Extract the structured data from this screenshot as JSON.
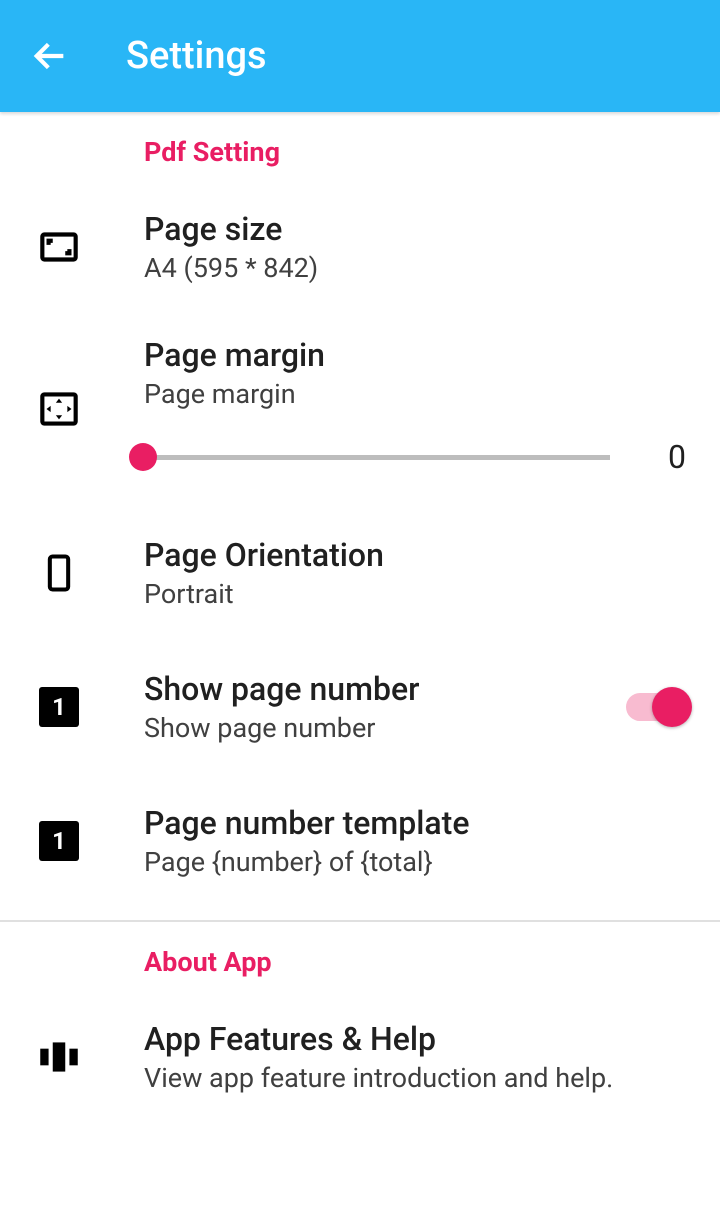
{
  "header": {
    "title": "Settings"
  },
  "sections": {
    "pdf": {
      "header": "Pdf Setting",
      "page_size": {
        "title": "Page size",
        "subtitle": "A4 (595 * 842)"
      },
      "page_margin": {
        "title": "Page margin",
        "subtitle": "Page margin",
        "value": "0"
      },
      "orientation": {
        "title": "Page Orientation",
        "subtitle": "Portrait"
      },
      "show_page_number": {
        "title": "Show page number",
        "subtitle": "Show page number",
        "toggle": true
      },
      "page_number_template": {
        "title": "Page number template",
        "subtitle": "Page {number} of {total}"
      }
    },
    "about": {
      "header": "About App",
      "features": {
        "title": "App Features & Help",
        "subtitle": "View app feature introduction and help."
      }
    }
  },
  "colors": {
    "header_bg": "#29b6f6",
    "accent": "#e91e63"
  }
}
